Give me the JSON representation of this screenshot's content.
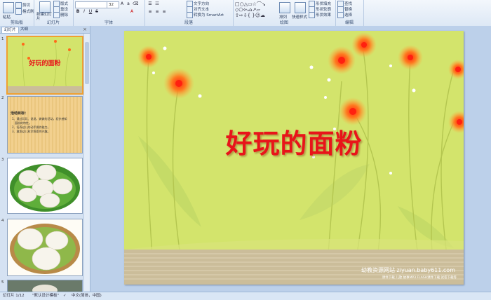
{
  "ribbon": {
    "groups": [
      {
        "title": "剪贴板",
        "buttons": [
          "粘贴",
          "剪切",
          "格式刷"
        ]
      },
      {
        "title": "幻灯片",
        "buttons": [
          "新建幻灯片",
          "版式",
          "重设",
          "删除"
        ]
      },
      {
        "title": "字体",
        "font_size": "32"
      },
      {
        "title": "段落",
        "buttons": [
          "文字方向",
          "对齐文本",
          "转换为 SmartArt"
        ]
      },
      {
        "title": "绘图",
        "buttons": [
          "排列",
          "快速样式",
          "形状填充",
          "形状轮廓",
          "形状效果"
        ]
      },
      {
        "title": "编辑",
        "buttons": [
          "查找",
          "替换",
          "选择"
        ]
      }
    ]
  },
  "left_pane": {
    "tabs": [
      "幻灯片",
      "大纲"
    ],
    "slides": [
      {
        "num": "1",
        "title": "好玩的面粉"
      },
      {
        "num": "2",
        "heading": "活动目标：",
        "lines": [
          "1、通过玩玩、说说，做做的活动，初步感知",
          "面粉的特性。",
          "2、培养幼儿的动手操作能力。",
          "3、激发幼儿科学探索的兴趣。"
        ]
      },
      {
        "num": "3"
      },
      {
        "num": "4"
      },
      {
        "num": "5"
      }
    ]
  },
  "slide": {
    "title": "好玩的面粉",
    "footer_main": "幼教资源网站  ziyuan.baby611.com",
    "footer_sub": "课件下载    儿歌    故事MP3    FLASH课件下载    试卷下载等"
  },
  "statusbar": {
    "slide_pos": "幻灯片 1/12",
    "theme": "\"默认设计模板\"",
    "language": "中文(简体，中国)"
  }
}
